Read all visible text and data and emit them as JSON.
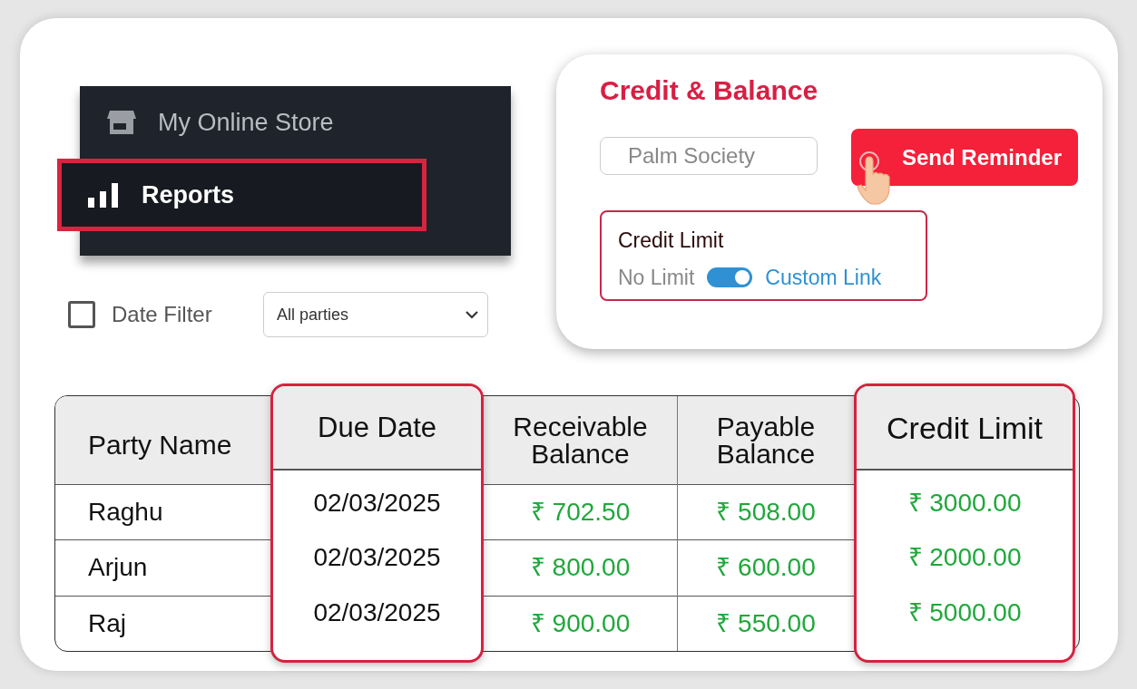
{
  "sidebar": {
    "items": [
      {
        "label": "My Online Store",
        "selected": false
      },
      {
        "label": "Reports",
        "selected": true
      }
    ]
  },
  "filters": {
    "date_filter": {
      "label": "Date Filter",
      "checked": false
    },
    "party_select": {
      "value": "All parties"
    }
  },
  "credit_panel": {
    "title": "Credit & Balance",
    "party_field": {
      "value": "Palm Society"
    },
    "send_button": "Send Reminder",
    "credit_limit": {
      "label": "Credit Limit",
      "off_label": "No Limit",
      "on_label": "Custom Link",
      "on": true
    }
  },
  "table": {
    "columns": [
      {
        "label": "Party Name",
        "kind": "text",
        "highlighted": false
      },
      {
        "label": "Due Date",
        "kind": "text",
        "highlighted": true
      },
      {
        "label": "Receivable Balance",
        "kind": "amount",
        "highlighted": false
      },
      {
        "label": "Payable Balance",
        "kind": "amount",
        "highlighted": false
      },
      {
        "label": "Credit Limit",
        "kind": "amount",
        "highlighted": true
      }
    ],
    "rows": [
      [
        "Raghu",
        "02/03/2025",
        "₹ 702.50",
        "₹ 508.00",
        "₹ 3000.00"
      ],
      [
        "Arjun",
        "02/03/2025",
        "₹ 800.00",
        "₹ 600.00",
        "₹ 2000.00"
      ],
      [
        "Raj",
        "02/03/2025",
        "₹ 900.00",
        "₹ 550.00",
        "₹ 5000.00"
      ]
    ]
  }
}
